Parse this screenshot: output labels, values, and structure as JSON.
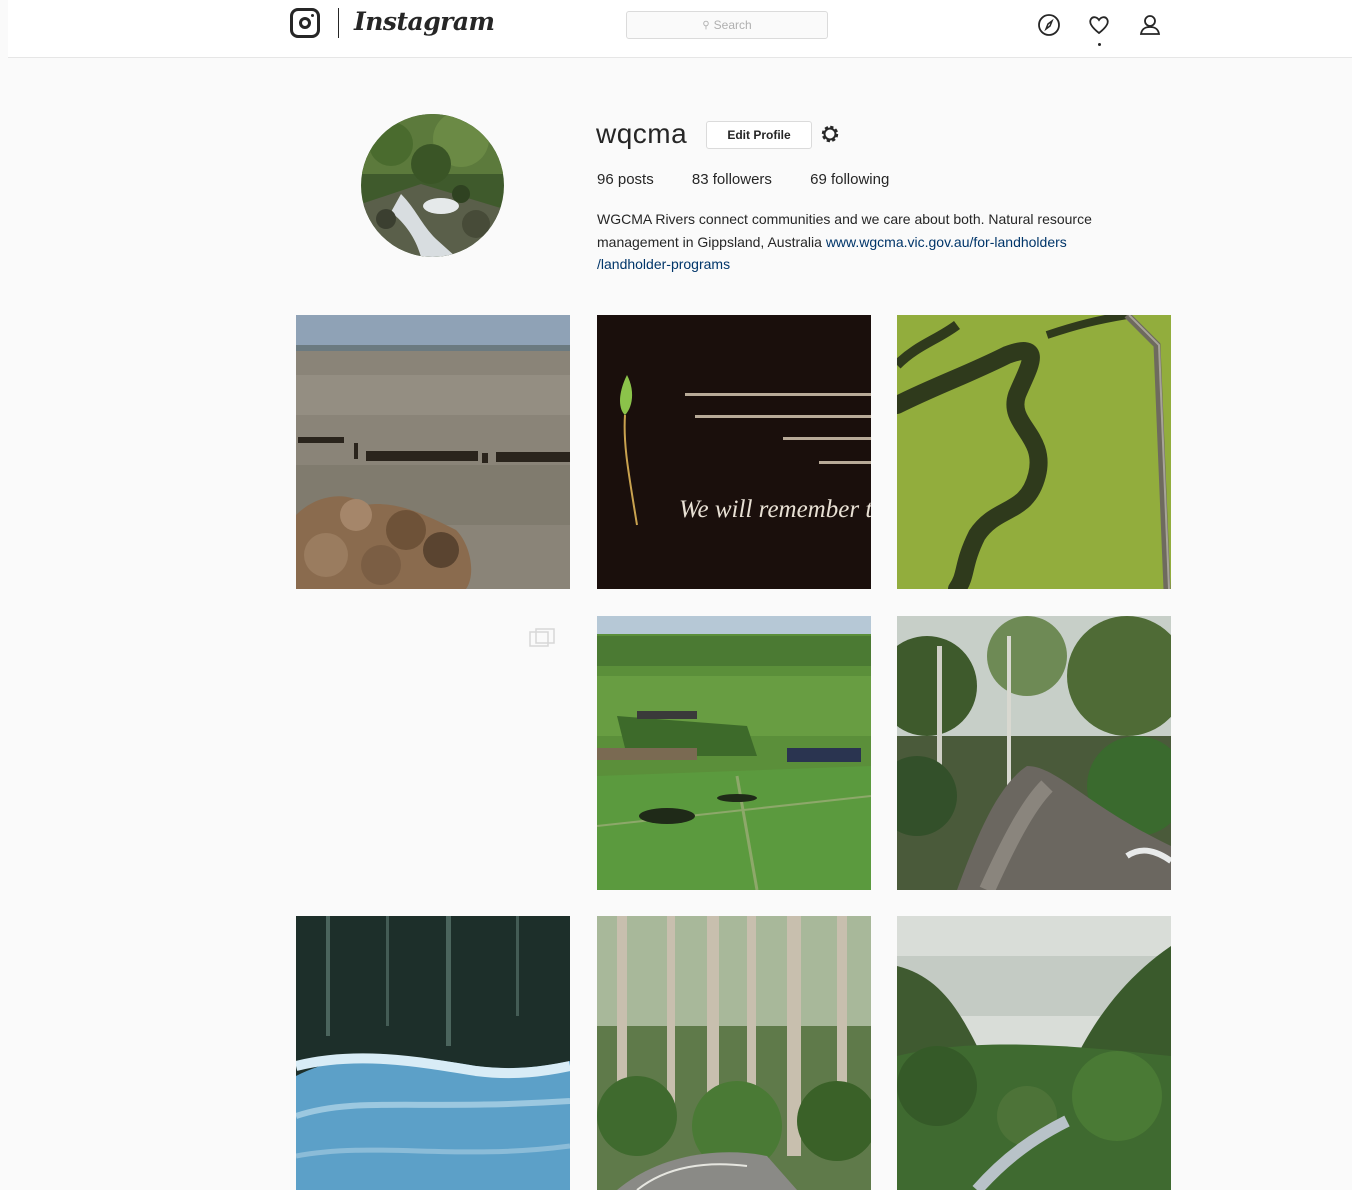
{
  "header": {
    "brand": "Instagram",
    "search_placeholder": "Search",
    "icons": [
      "instagram-camera-icon",
      "compass-icon",
      "heart-icon",
      "person-icon"
    ]
  },
  "profile": {
    "username": "wqcma",
    "edit_profile_label": "Edit Profile",
    "stats": {
      "posts": "96 posts",
      "followers": "83 followers",
      "following": "69 following"
    },
    "bio_text": "WGCMA Rivers connect communities and we care about both. Natural resource management in Gippsland, Australia",
    "bio_link_line1": "www.wgcma.vic.gov.au/for-landholders",
    "bio_link_line2": "/landholder-programs"
  },
  "posts": [
    {
      "subject": "lake with jetty posts and rocks"
    },
    {
      "subject": "remembrance message with leaf",
      "text": "We will remember th"
    },
    {
      "subject": "aerial view of winding creek through green farmland"
    },
    {
      "subject": "blank post with carousel icon"
    },
    {
      "subject": "aerial view of green rolling farmland"
    },
    {
      "subject": "river through forest"
    },
    {
      "subject": "water flowing over weir"
    },
    {
      "subject": "tall eucalyptus forest with road"
    },
    {
      "subject": "misty forest valley with river"
    }
  ],
  "colors": {
    "background": "#fafafa",
    "text": "#262626",
    "link": "#003569",
    "border": "#dbdbdb"
  }
}
